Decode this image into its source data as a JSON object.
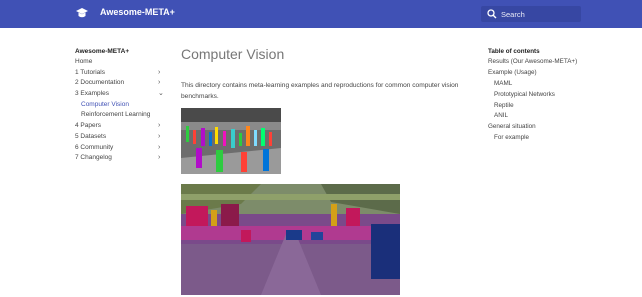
{
  "header": {
    "site_title": "Awesome-META+",
    "logo_icon": "graduation-cap-icon",
    "search": {
      "placeholder": "Search",
      "icon": "search-icon"
    },
    "color": "#4051b5"
  },
  "nav": {
    "title": "Awesome-META+",
    "items": [
      {
        "label": "Home"
      },
      {
        "label": "1 Tutorials",
        "chevron": "›"
      },
      {
        "label": "2 Documentation",
        "chevron": "›"
      },
      {
        "label": "3 Examples",
        "chevron": "⌄"
      },
      {
        "label": "Computer Vision",
        "active": true
      },
      {
        "label": "Reinforcement Learning"
      },
      {
        "label": "4 Papers",
        "chevron": "›"
      },
      {
        "label": "5 Datasets",
        "chevron": "›"
      },
      {
        "label": "6 Community",
        "chevron": "›"
      },
      {
        "label": "7 Changelog",
        "chevron": "›"
      }
    ]
  },
  "main": {
    "title": "Computer Vision",
    "intro": "This directory contains meta-learning examples and reproductions for common computer vision benchmarks."
  },
  "toc": {
    "title": "Table of contents",
    "items": [
      {
        "label": "Results (Our Awesome-META+)"
      },
      {
        "label": "Example (Usage)"
      },
      {
        "label": "MAML"
      },
      {
        "label": "Prototypical Networks"
      },
      {
        "label": "Reptile"
      },
      {
        "label": "ANIL"
      },
      {
        "label": "General situation"
      },
      {
        "label": "For example"
      }
    ]
  },
  "colors": {
    "accent": "#4051b5",
    "active_link": "#4051b5"
  }
}
